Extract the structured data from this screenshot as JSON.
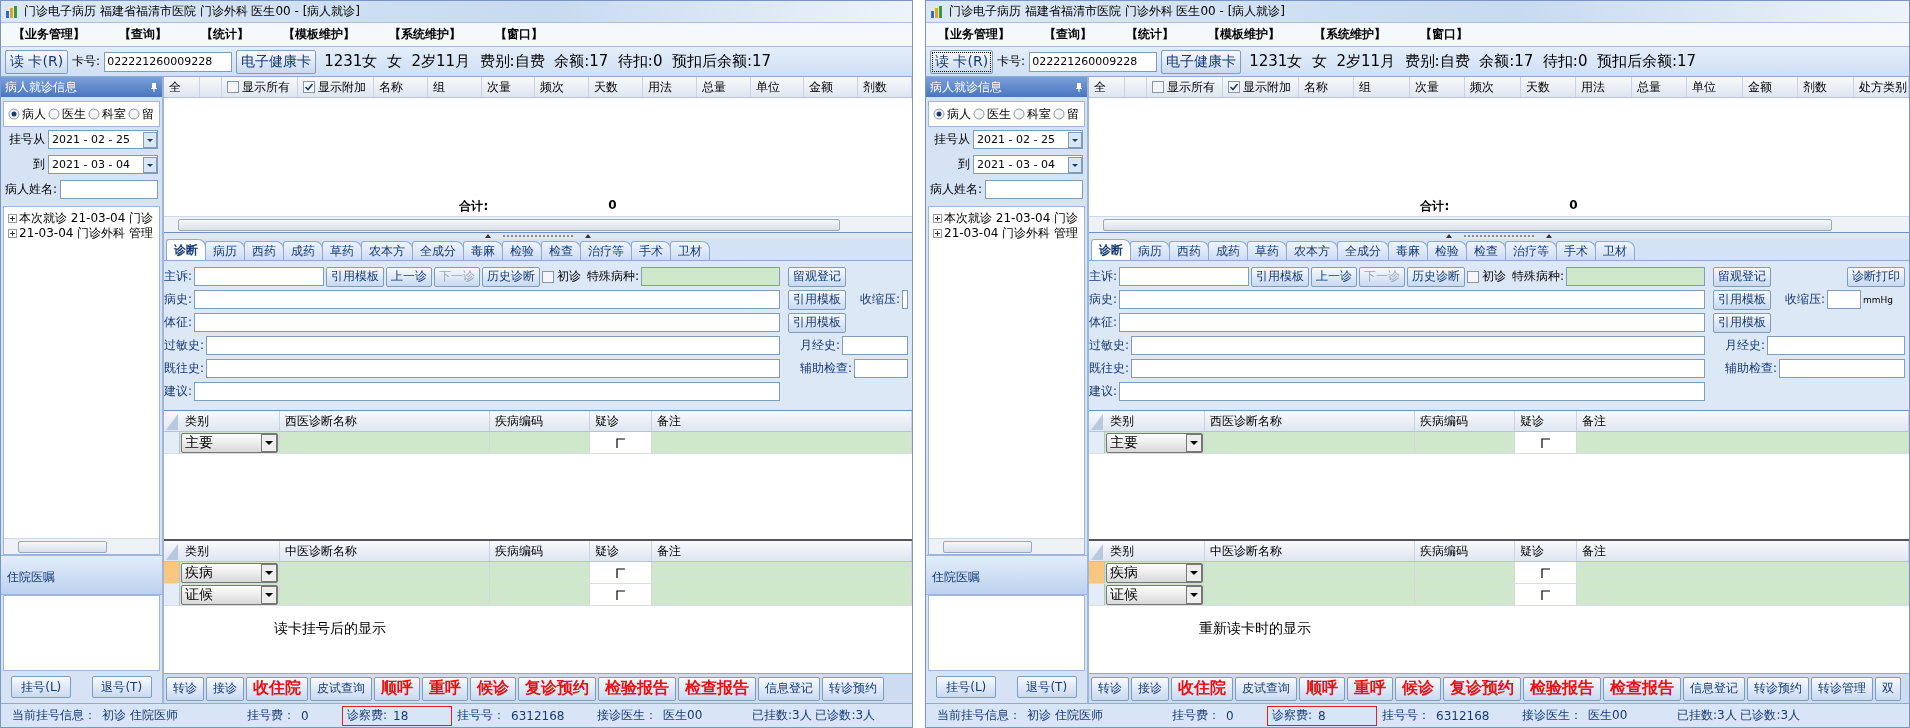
{
  "windows": [
    {
      "title": "门诊电子病历  福建省福清市医院  门诊外科  医生00 - [病人就诊]",
      "menu": [
        "【业务管理】",
        "【查询】",
        "【统计】",
        "【模板维护】",
        "【系统维护】",
        "【窗口】"
      ],
      "patient_bar": {
        "read_card": {
          "label": "读 卡(R)",
          "focused": false
        },
        "card_label": "卡号:",
        "card_number": "022221260009228",
        "health_card": "电子健康卡",
        "info": "1231女  女  2岁11月  费别:自费  余额:17  待扣:0  预扣后余额:17"
      },
      "sidebar": {
        "title": "病人就诊信息",
        "radios": [
          {
            "label": "病人",
            "selected": true
          },
          {
            "label": "医生",
            "selected": false
          },
          {
            "label": "科室",
            "selected": false
          },
          {
            "label": "留",
            "selected": false
          }
        ],
        "date_from": {
          "label": "挂号从",
          "value": "2021 - 02 - 25"
        },
        "date_to": {
          "label": "到",
          "value": "2021 - 03 - 04"
        },
        "name_label": "病人姓名:",
        "tree": [
          {
            "label": "本次就诊 21-03-04 门诊",
            "expanded": false
          },
          {
            "label": "21-03-04 门诊外科 管理",
            "expanded": false
          }
        ],
        "orders_title": "住院医嘱",
        "buttons": [
          "挂号(L)",
          "退号(T)"
        ]
      },
      "prescriptions": {
        "first_column": "全",
        "toggles": [
          {
            "label": "显示所有",
            "checked": false
          },
          {
            "label": "显示附加",
            "checked": true
          }
        ],
        "columns": [
          "名称",
          "组",
          "次量",
          "频次",
          "天数",
          "用法",
          "总量",
          "单位",
          "金额",
          "剂数"
        ],
        "total_label": "合计:",
        "total_value": "0"
      },
      "tabs": [
        {
          "label": "诊断",
          "selected": true
        },
        {
          "label": "病历",
          "selected": false
        },
        {
          "label": "西药",
          "selected": false
        },
        {
          "label": "成药",
          "selected": false
        },
        {
          "label": "草药",
          "selected": false
        },
        {
          "label": "农本方",
          "selected": false
        },
        {
          "label": "全成分",
          "selected": false
        },
        {
          "label": "毒麻",
          "selected": false
        },
        {
          "label": "检验",
          "selected": false
        },
        {
          "label": "检查",
          "selected": false
        },
        {
          "label": "治疗等",
          "selected": false
        },
        {
          "label": "手术",
          "selected": false
        },
        {
          "label": "卫材",
          "selected": false
        }
      ],
      "form": [
        {
          "label": "主诉:",
          "tools": [
            {
              "label": "引用模板",
              "disabled": false
            },
            {
              "label": "上一诊",
              "disabled": false
            },
            {
              "label": "下一诊",
              "disabled": true
            },
            {
              "label": "历史诊断",
              "disabled": false
            }
          ],
          "first_visit": {
            "label": "初诊",
            "checked": false
          },
          "special_label": "特殊病种:",
          "side": [
            {
              "kind": "button",
              "label": "留观登记"
            }
          ]
        },
        {
          "label": "病史:",
          "side": [
            {
              "kind": "button",
              "label": "引用模板"
            },
            {
              "kind": "label",
              "label": "收缩压:"
            },
            {
              "kind": "field"
            }
          ]
        },
        {
          "label": "体征:",
          "side": [
            {
              "kind": "button",
              "label": "引用模板"
            }
          ]
        },
        {
          "label": "过敏史:",
          "side": [
            {
              "kind": "label",
              "label": "月经史:"
            },
            {
              "kind": "field"
            }
          ]
        },
        {
          "label": "既往史:",
          "side": [
            {
              "kind": "label",
              "label": "辅助检查:"
            },
            {
              "kind": "field"
            }
          ]
        },
        {
          "label": "建议:"
        }
      ],
      "western_grid": {
        "columns": [
          "类别",
          "西医诊断名称",
          "疾病编码",
          "疑诊",
          "备注"
        ],
        "rows": [
          {
            "type": "主要",
            "suspect": false,
            "selected": false
          }
        ]
      },
      "chinese_grid": {
        "columns": [
          "类别",
          "中医诊断名称",
          "疾病编码",
          "疑诊",
          "备注"
        ],
        "rows": [
          {
            "type": "疾病",
            "suspect": false,
            "selected": true
          },
          {
            "type": "证候",
            "suspect": false,
            "selected": false
          }
        ]
      },
      "caption": "读卡挂号后的显示",
      "actions": [
        {
          "label": "转诊",
          "kind": "normal"
        },
        {
          "label": "接诊",
          "kind": "normal"
        },
        {
          "label": "收住院",
          "kind": "alert"
        },
        {
          "label": "皮试查询",
          "kind": "normal"
        },
        {
          "label": "顺呼",
          "kind": "alert"
        },
        {
          "label": "重呼",
          "kind": "alert"
        },
        {
          "label": "候诊",
          "kind": "alert"
        },
        {
          "label": "复诊预约",
          "kind": "alert"
        },
        {
          "label": "检验报告",
          "kind": "alert"
        },
        {
          "label": "检查报告",
          "kind": "alert"
        },
        {
          "label": "信息登记",
          "kind": "normal"
        },
        {
          "label": "转诊预约",
          "kind": "normal"
        }
      ],
      "status": [
        {
          "label": "当前挂号信息：",
          "value": "初诊 住院医师",
          "highlighted": false
        },
        {
          "label": "挂号费：",
          "value": "0",
          "highlighted": false
        },
        {
          "label": "诊察费:",
          "value": "18",
          "highlighted": true
        },
        {
          "label": "挂号号：",
          "value": "6312168",
          "highlighted": false
        },
        {
          "label": "接诊医生：",
          "value": "医生00",
          "highlighted": false
        },
        {
          "label": "已挂数:3人 已诊数:3人",
          "highlighted": false
        }
      ]
    },
    {
      "title": "门诊电子病历  福建省福清市医院  门诊外科  医生00 - [病人就诊]",
      "menu": [
        "【业务管理】",
        "【查询】",
        "【统计】",
        "【模板维护】",
        "【系统维护】",
        "【窗口】"
      ],
      "patient_bar": {
        "read_card": {
          "label": "读 卡(R)",
          "focused": true
        },
        "card_label": "卡号:",
        "card_number": "022221260009228",
        "health_card": "电子健康卡",
        "info": "1231女  女  2岁11月  费别:自费  余额:17  待扣:0  预扣后余额:17"
      },
      "sidebar": {
        "title": "病人就诊信息",
        "radios": [
          {
            "label": "病人",
            "selected": true
          },
          {
            "label": "医生",
            "selected": false
          },
          {
            "label": "科室",
            "selected": false
          },
          {
            "label": "留",
            "selected": false
          }
        ],
        "date_from": {
          "label": "挂号从",
          "value": "2021 - 02 - 25"
        },
        "date_to": {
          "label": "到",
          "value": "2021 - 03 - 04"
        },
        "name_label": "病人姓名:",
        "tree": [
          {
            "label": "本次就诊 21-03-04 门诊",
            "expanded": false
          },
          {
            "label": "21-03-04 门诊外科 管理",
            "expanded": false
          }
        ],
        "orders_title": "住院医嘱",
        "buttons": [
          "挂号(L)",
          "退号(T)"
        ]
      },
      "prescriptions": {
        "first_column": "全",
        "toggles": [
          {
            "label": "显示所有",
            "checked": false
          },
          {
            "label": "显示附加",
            "checked": true
          }
        ],
        "columns": [
          "名称",
          "组",
          "次量",
          "频次",
          "天数",
          "用法",
          "总量",
          "单位",
          "金额",
          "剂数",
          "处方类别"
        ],
        "total_label": "合计:",
        "total_value": "0"
      },
      "tabs": [
        {
          "label": "诊断",
          "selected": true
        },
        {
          "label": "病历",
          "selected": false
        },
        {
          "label": "西药",
          "selected": false
        },
        {
          "label": "成药",
          "selected": false
        },
        {
          "label": "草药",
          "selected": false
        },
        {
          "label": "农本方",
          "selected": false
        },
        {
          "label": "全成分",
          "selected": false
        },
        {
          "label": "毒麻",
          "selected": false
        },
        {
          "label": "检验",
          "selected": false
        },
        {
          "label": "检查",
          "selected": false
        },
        {
          "label": "治疗等",
          "selected": false
        },
        {
          "label": "手术",
          "selected": false
        },
        {
          "label": "卫材",
          "selected": false
        }
      ],
      "form": [
        {
          "label": "主诉:",
          "tools": [
            {
              "label": "引用模板",
              "disabled": false
            },
            {
              "label": "上一诊",
              "disabled": false
            },
            {
              "label": "下一诊",
              "disabled": true
            },
            {
              "label": "历史诊断",
              "disabled": false
            }
          ],
          "first_visit": {
            "label": "初诊",
            "checked": false
          },
          "special_label": "特殊病种:",
          "side": [
            {
              "kind": "button",
              "label": "留观登记"
            },
            {
              "kind": "gap"
            },
            {
              "kind": "button",
              "label": "诊断打印"
            }
          ]
        },
        {
          "label": "病史:",
          "side": [
            {
              "kind": "button",
              "label": "引用模板"
            },
            {
              "kind": "label",
              "label": "收缩压:"
            },
            {
              "kind": "small_field"
            },
            {
              "kind": "unit",
              "label": "mmHg"
            }
          ]
        },
        {
          "label": "体征:",
          "side": [
            {
              "kind": "button",
              "label": "引用模板"
            }
          ]
        },
        {
          "label": "过敏史:",
          "side": [
            {
              "kind": "label",
              "label": "月经史:"
            },
            {
              "kind": "field"
            }
          ]
        },
        {
          "label": "既往史:",
          "side": [
            {
              "kind": "label",
              "label": "辅助检查:"
            },
            {
              "kind": "field"
            }
          ]
        },
        {
          "label": "建议:"
        }
      ],
      "western_grid": {
        "columns": [
          "类别",
          "西医诊断名称",
          "疾病编码",
          "疑诊",
          "备注"
        ],
        "rows": [
          {
            "type": "主要",
            "suspect": false,
            "selected": false
          }
        ]
      },
      "chinese_grid": {
        "columns": [
          "类别",
          "中医诊断名称",
          "疾病编码",
          "疑诊",
          "备注"
        ],
        "rows": [
          {
            "type": "疾病",
            "suspect": false,
            "selected": true
          },
          {
            "type": "证候",
            "suspect": false,
            "selected": false
          }
        ]
      },
      "caption": "重新读卡时的显示",
      "actions": [
        {
          "label": "转诊",
          "kind": "normal"
        },
        {
          "label": "接诊",
          "kind": "normal"
        },
        {
          "label": "收住院",
          "kind": "alert"
        },
        {
          "label": "皮试查询",
          "kind": "normal"
        },
        {
          "label": "顺呼",
          "kind": "alert"
        },
        {
          "label": "重呼",
          "kind": "alert"
        },
        {
          "label": "候诊",
          "kind": "alert"
        },
        {
          "label": "复诊预约",
          "kind": "alert"
        },
        {
          "label": "检验报告",
          "kind": "alert"
        },
        {
          "label": "检查报告",
          "kind": "alert"
        },
        {
          "label": "信息登记",
          "kind": "normal"
        },
        {
          "label": "转诊预约",
          "kind": "normal"
        },
        {
          "label": "转诊管理",
          "kind": "normal"
        },
        {
          "label": "双",
          "kind": "normal"
        }
      ],
      "status": [
        {
          "label": "当前挂号信息：",
          "value": "初诊 住院医师",
          "highlighted": false
        },
        {
          "label": "挂号费：",
          "value": "0",
          "highlighted": false
        },
        {
          "label": "诊察费:",
          "value": "8",
          "highlighted": true
        },
        {
          "label": "挂号号：",
          "value": "6312168",
          "highlighted": false
        },
        {
          "label": "接诊医生：",
          "value": "医生00",
          "highlighted": false
        },
        {
          "label": "已挂数:3人 已诊数:3人",
          "highlighted": false
        }
      ]
    }
  ]
}
